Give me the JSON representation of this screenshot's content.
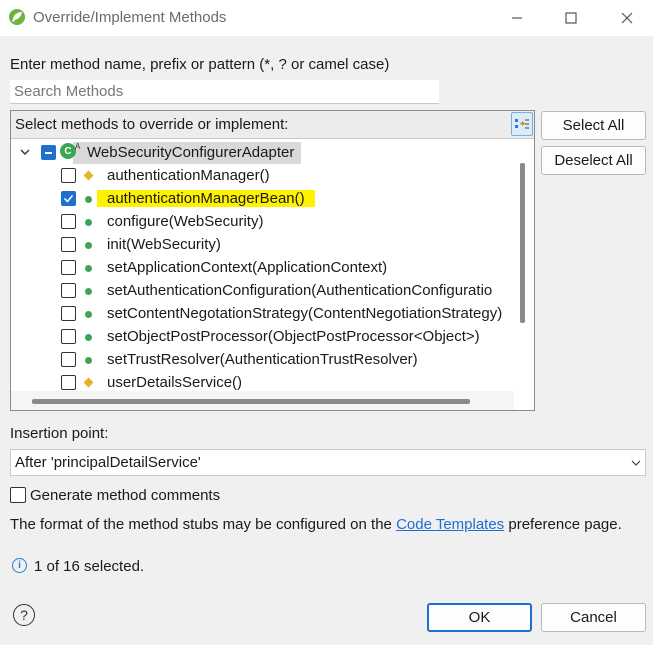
{
  "window": {
    "title": "Override/Implement Methods",
    "icon": "spring-leaf-icon",
    "minimize": "–",
    "maximize": "☐",
    "close": "✕"
  },
  "search": {
    "label": "Enter method name, prefix or pattern (*, ? or camel case)",
    "placeholder": "Search Methods",
    "value": ""
  },
  "tree": {
    "header": "Select methods to override or implement:",
    "root": {
      "label": "WebSecurityConfigurerAdapter",
      "class_badge": "C",
      "class_sup": "A",
      "state": "partial",
      "expanded": true
    },
    "items": [
      {
        "label": "authenticationManager()",
        "checked": false,
        "visibility": "protected"
      },
      {
        "label": "authenticationManagerBean()",
        "checked": true,
        "visibility": "public",
        "highlighted": true
      },
      {
        "label": "configure(WebSecurity)",
        "checked": false,
        "visibility": "public"
      },
      {
        "label": "init(WebSecurity)",
        "checked": false,
        "visibility": "public"
      },
      {
        "label": "setApplicationContext(ApplicationContext)",
        "checked": false,
        "visibility": "public"
      },
      {
        "label": "setAuthenticationConfiguration(AuthenticationConfiguratio",
        "checked": false,
        "visibility": "public"
      },
      {
        "label": "setContentNegotationStrategy(ContentNegotiationStrategy)",
        "checked": false,
        "visibility": "public"
      },
      {
        "label": "setObjectPostProcessor(ObjectPostProcessor<Object>)",
        "checked": false,
        "visibility": "public"
      },
      {
        "label": "setTrustResolver(AuthenticationTrustResolver)",
        "checked": false,
        "visibility": "public"
      },
      {
        "label": "userDetailsService()",
        "checked": false,
        "visibility": "protected"
      }
    ]
  },
  "buttons": {
    "select_all": "Select All",
    "deselect_all": "Deselect All",
    "ok": "OK",
    "cancel": "Cancel"
  },
  "insertion": {
    "label": "Insertion point:",
    "value": "After 'principalDetailService'"
  },
  "generate_comments": {
    "label": "Generate method comments",
    "checked": false
  },
  "format_note": {
    "prefix": "The format of the method stubs may be configured on the ",
    "link": "Code Templates",
    "suffix": " preference page."
  },
  "status": {
    "text": "1 of 16 selected."
  },
  "colors": {
    "accent": "#1e6fce",
    "public_dot": "#3aa655",
    "protected_diamond": "#e6b324",
    "highlight": "#fff200",
    "link": "#1f6fd1"
  }
}
